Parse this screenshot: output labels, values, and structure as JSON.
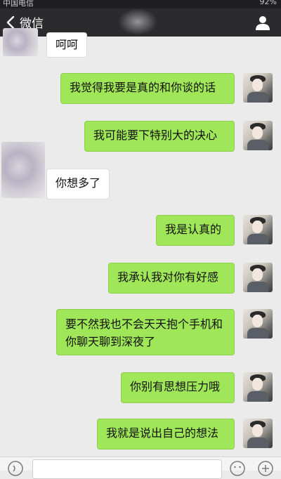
{
  "status": {
    "carrier": "中国电信",
    "battery": "92%"
  },
  "nav": {
    "back_label": "微信"
  },
  "messages": [
    {
      "side": "left",
      "text": "呵呵"
    },
    {
      "side": "right",
      "text": "我觉得我要是真的和你谈的话"
    },
    {
      "side": "right",
      "text": "我可能要下特别大的决心"
    },
    {
      "side": "left",
      "text": "你想多了"
    },
    {
      "side": "right",
      "text": "我是认真的"
    },
    {
      "side": "right",
      "text": "我承认我对你有好感"
    },
    {
      "side": "right",
      "text": "要不然我也不会天天抱个手机和你聊天聊到深夜了"
    },
    {
      "side": "right",
      "text": "你别有思想压力哦"
    },
    {
      "side": "right",
      "text": "我就是说出自己的想法"
    }
  ],
  "colors": {
    "bubble_green": "#9fe658",
    "bubble_white": "#ffffff",
    "navbar": "#2b2b2e",
    "background": "#ebebeb"
  },
  "icons": {
    "back": "back-chevron-icon",
    "profile": "person-icon",
    "voice": "voice-icon",
    "emoji": "emoji-icon",
    "more": "plus-icon"
  }
}
